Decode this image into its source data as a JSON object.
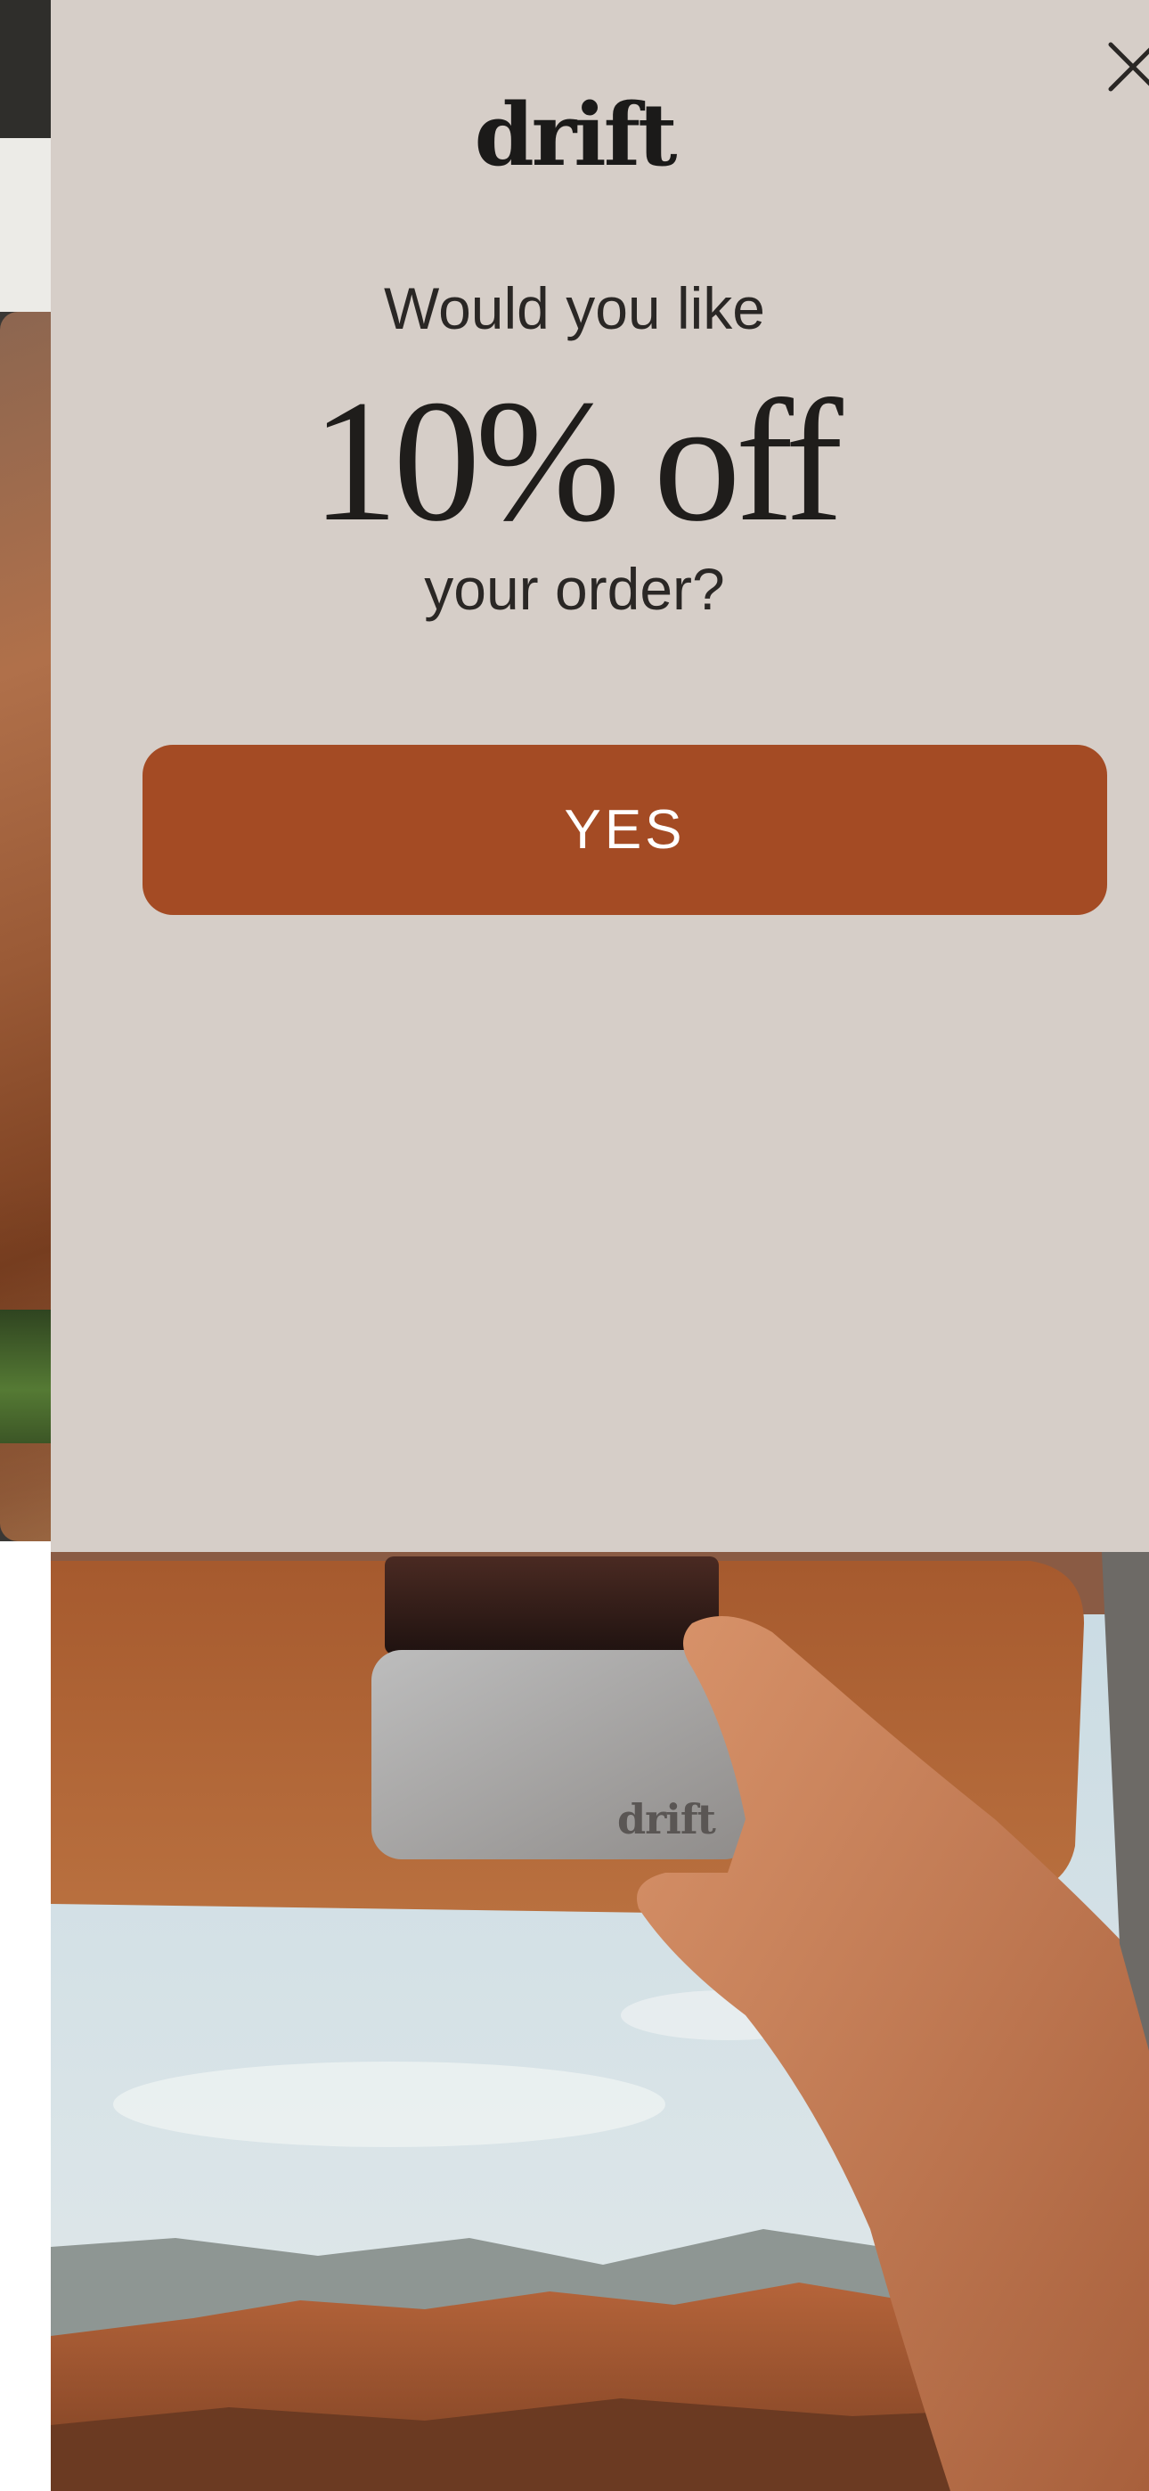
{
  "popup": {
    "brand": "drift",
    "headline": "Would you like",
    "offer": "10% off",
    "subline": "your order?",
    "cta_label": "YES",
    "close_icon": "close-icon"
  },
  "product_image": {
    "emboss_text": "drift"
  },
  "background_page": {
    "menu_icon": "hamburger-menu-icon"
  },
  "colors": {
    "panel_bg": "#d6cec8",
    "cta_bg": "#a44b24",
    "cta_text": "#ffffff",
    "text": "#1f1d1b"
  }
}
